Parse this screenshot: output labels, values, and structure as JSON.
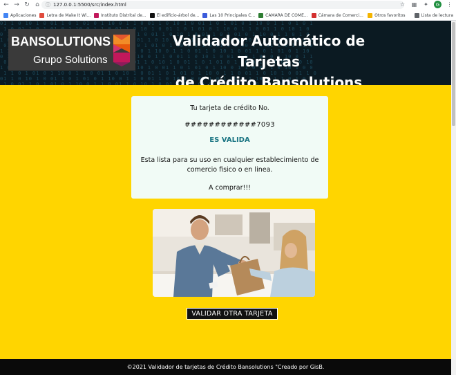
{
  "browser": {
    "url": "127.0.0.1:5500/src/index.html",
    "bookmarks": [
      {
        "label": "Aplicaciones",
        "color": "#4285f4"
      },
      {
        "label": "Letra de Make It Wi...",
        "color": "#e04b3c"
      },
      {
        "label": "Instituto Distrital de...",
        "color": "#c2185b"
      },
      {
        "label": "El edificio-árbol de...",
        "color": "#111111"
      },
      {
        "label": "Las 10 Principales C...",
        "color": "#3b5bdb"
      },
      {
        "label": "CAMARA DE COME...",
        "color": "#2e7d32"
      },
      {
        "label": "Cámara de Comerci...",
        "color": "#d32f2f"
      }
    ],
    "bookmarks_right": [
      {
        "label": "Otros favoritos",
        "color": "#f4b400"
      },
      {
        "label": "Lista de lectura",
        "color": "#5f6368"
      }
    ],
    "avatar_letter": "G"
  },
  "header": {
    "logo_title": "BANSOLUTIONS",
    "logo_sub": "Grupo Solutions",
    "title_line1": "Validador Automático de Tarjetas",
    "title_line2": "de Crédito Bansolutions"
  },
  "result": {
    "line1": "Tu tarjeta de crédito No.",
    "card_number": "############7093",
    "status": "ES VALIDA",
    "message": "Esta lista para su uso en cualquier establecimiento de comercio fisico o en linea.",
    "cta": "A comprar!!!"
  },
  "button": {
    "label": "VALIDAR OTRA TARJETA"
  },
  "footer": {
    "text": "©2021 Validador de tarjetas de Crédito Bansolutions \"Creado por GisB."
  },
  "colors": {
    "page_bg": "#ffd500",
    "status": "#1b7583",
    "header_bg": "#0b1a22"
  }
}
